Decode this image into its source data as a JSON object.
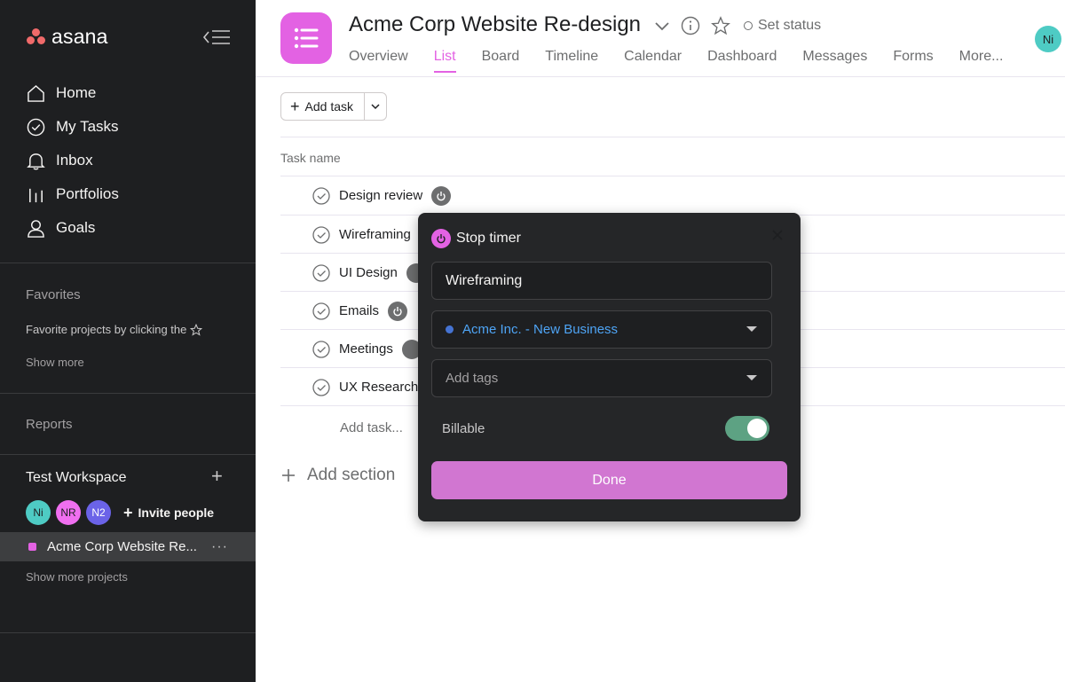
{
  "sidebar": {
    "logo_text": "asana",
    "nav": [
      {
        "label": "Home",
        "icon": "home-icon"
      },
      {
        "label": "My Tasks",
        "icon": "check-circle-icon"
      },
      {
        "label": "Inbox",
        "icon": "bell-icon"
      },
      {
        "label": "Portfolios",
        "icon": "bar-chart-icon"
      },
      {
        "label": "Goals",
        "icon": "person-icon"
      }
    ],
    "favorites": {
      "title": "Favorites",
      "hint": "Favorite projects by clicking the",
      "show_more": "Show more"
    },
    "reports": {
      "title": "Reports"
    },
    "workspace": {
      "title": "Test Workspace",
      "members": [
        {
          "initials": "Ni",
          "color": "#4ecbc4"
        },
        {
          "initials": "NR",
          "color": "#f06ff0"
        },
        {
          "initials": "N2",
          "color": "#6b63e8"
        }
      ],
      "invite_label": "Invite people",
      "project": "Acme Corp Website Re...",
      "show_more_projects": "Show more projects"
    }
  },
  "header": {
    "project_title": "Acme Corp Website Re-design",
    "set_status": "Set status",
    "user_initials": "Ni",
    "tabs": [
      {
        "label": "Overview",
        "active": false
      },
      {
        "label": "List",
        "active": true
      },
      {
        "label": "Board",
        "active": false
      },
      {
        "label": "Timeline",
        "active": false
      },
      {
        "label": "Calendar",
        "active": false
      },
      {
        "label": "Dashboard",
        "active": false
      },
      {
        "label": "Messages",
        "active": false
      },
      {
        "label": "Forms",
        "active": false
      },
      {
        "label": "More...",
        "active": false
      }
    ]
  },
  "toolbar": {
    "add_task_label": "Add task"
  },
  "list": {
    "column_header": "Task name",
    "tasks": [
      {
        "name": "Design review",
        "timer": true
      },
      {
        "name": "Wireframing",
        "timer": true
      },
      {
        "name": "UI Design",
        "timer": true
      },
      {
        "name": "Emails",
        "timer": true
      },
      {
        "name": "Meetings",
        "timer": true
      },
      {
        "name": "UX Research",
        "timer": false
      }
    ],
    "add_task_inline": "Add task...",
    "add_section": "Add section"
  },
  "timer_popover": {
    "title": "Stop timer",
    "task_value": "Wireframing",
    "project_value": "Acme Inc. - New Business",
    "tags_placeholder": "Add tags",
    "billable_label": "Billable",
    "billable_on": true,
    "done_label": "Done"
  },
  "colors": {
    "accent": "#e362e3",
    "sidebar_bg": "#1e1f21",
    "toggle_on": "#5da283",
    "done_button": "#d176d1"
  }
}
